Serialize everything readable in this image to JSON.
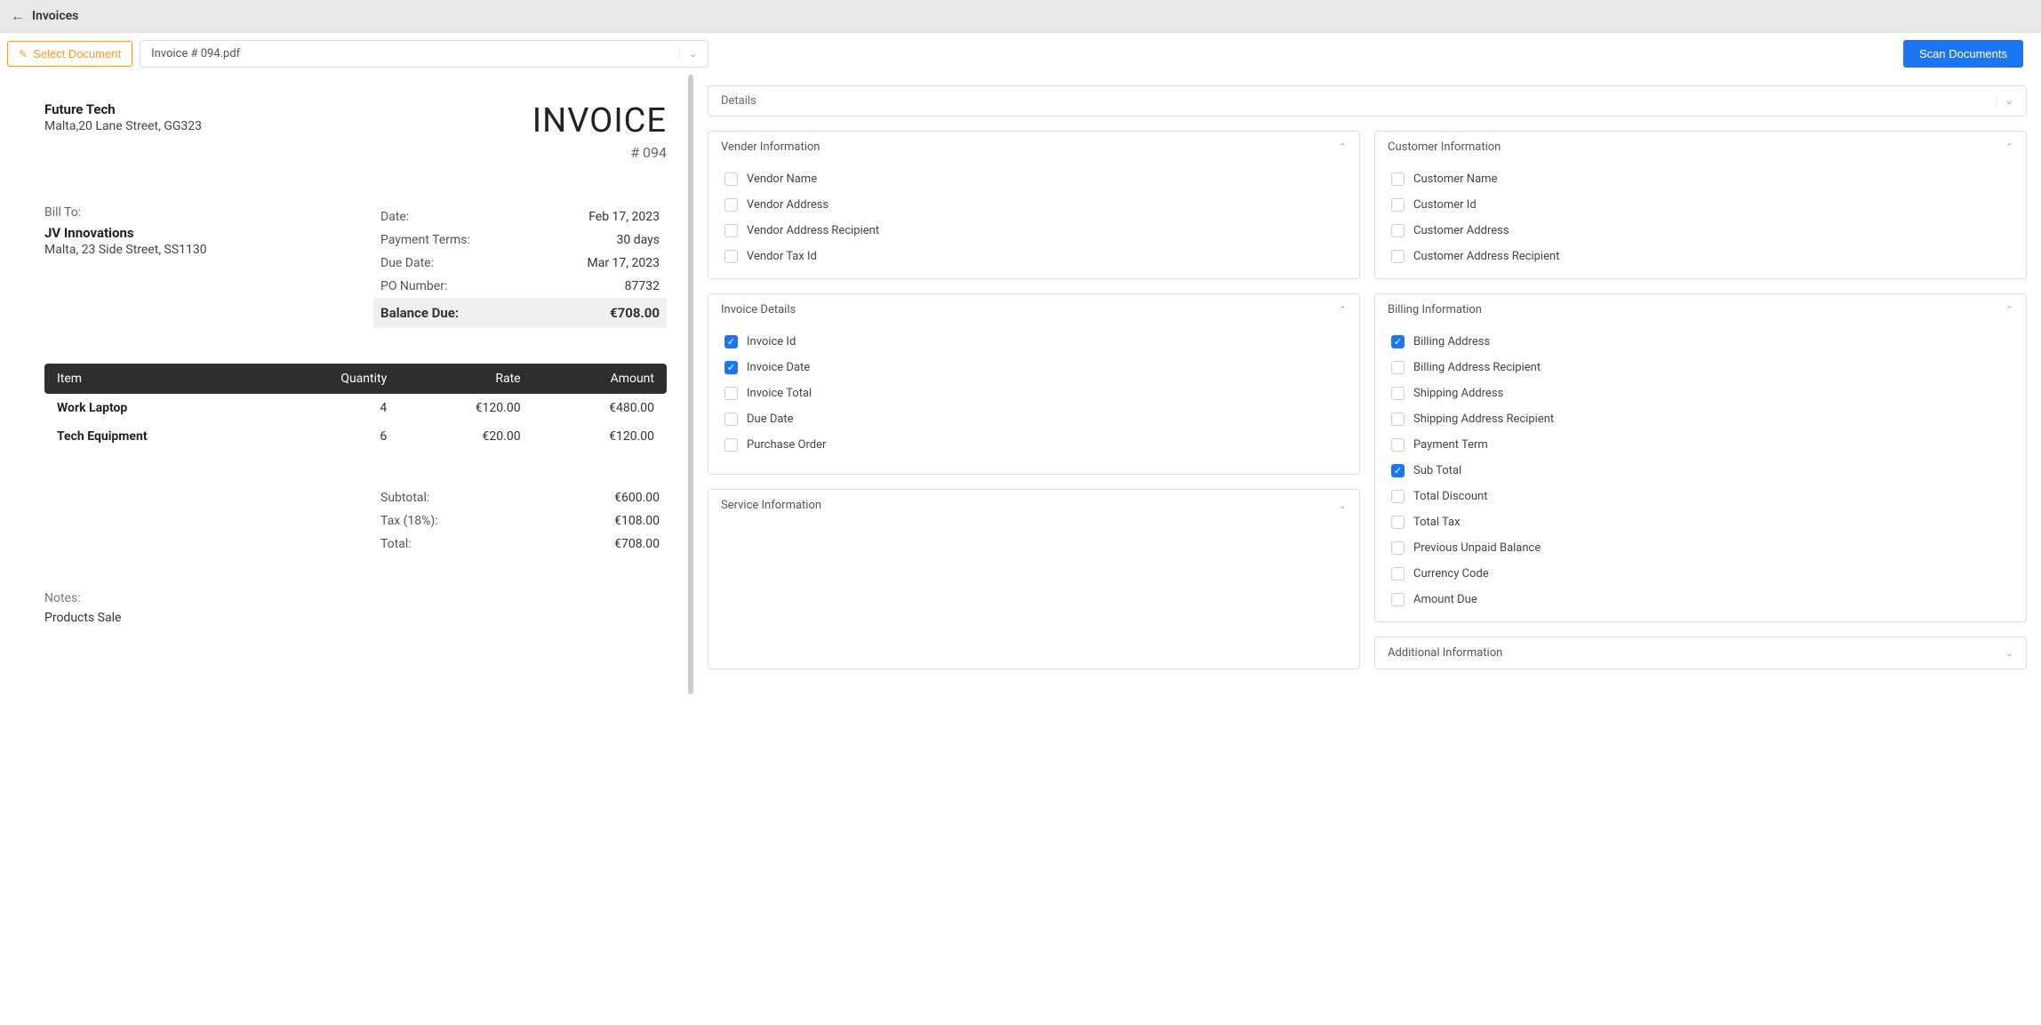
{
  "header": {
    "title": "Invoices"
  },
  "toolbar": {
    "select_doc_label": "Select Document",
    "doc_name": "Invoice # 094.pdf",
    "scan_label": "Scan Documents"
  },
  "invoice": {
    "vendor_name": "Future Tech",
    "vendor_address": "Malta,20 Lane Street, GG323",
    "title": "INVOICE",
    "number": "# 094",
    "bill_to_label": "Bill To:",
    "bill_to_name": "JV Innovations",
    "bill_to_address": "Malta, 23 Side Street, SS1130",
    "meta": {
      "date_label": "Date:",
      "date_value": "Feb 17, 2023",
      "terms_label": "Payment Terms:",
      "terms_value": "30 days",
      "due_label": "Due Date:",
      "due_value": "Mar 17, 2023",
      "po_label": "PO Number:",
      "po_value": "87732",
      "balance_label": "Balance Due:",
      "balance_value": "€708.00"
    },
    "columns": {
      "item": "Item",
      "qty": "Quantity",
      "rate": "Rate",
      "amount": "Amount"
    },
    "items": [
      {
        "name": "Work Laptop",
        "qty": "4",
        "rate": "€120.00",
        "amount": "€480.00"
      },
      {
        "name": "Tech Equipment",
        "qty": "6",
        "rate": "€20.00",
        "amount": "€120.00"
      }
    ],
    "totals": {
      "subtotal_label": "Subtotal:",
      "subtotal_value": "€600.00",
      "tax_label": "Tax (18%):",
      "tax_value": "€108.00",
      "total_label": "Total:",
      "total_value": "€708.00"
    },
    "notes_label": "Notes:",
    "notes_text": "Products Sale"
  },
  "details_dropdown": "Details",
  "panels": {
    "vendor": {
      "title": "Vender Information",
      "fields": [
        {
          "label": "Vendor Name",
          "checked": false
        },
        {
          "label": "Vendor Address",
          "checked": false
        },
        {
          "label": "Vendor Address Recipient",
          "checked": false
        },
        {
          "label": "Vendor Tax Id",
          "checked": false
        }
      ]
    },
    "customer": {
      "title": "Customer Information",
      "fields": [
        {
          "label": "Customer Name",
          "checked": false
        },
        {
          "label": "Customer Id",
          "checked": false
        },
        {
          "label": "Customer Address",
          "checked": false
        },
        {
          "label": "Customer Address Recipient",
          "checked": false
        }
      ]
    },
    "invoice_details": {
      "title": "Invoice Details",
      "fields": [
        {
          "label": "Invoice Id",
          "checked": true
        },
        {
          "label": "Invoice Date",
          "checked": true
        },
        {
          "label": "Invoice Total",
          "checked": false
        },
        {
          "label": "Due Date",
          "checked": false
        },
        {
          "label": "Purchase Order",
          "checked": false
        }
      ]
    },
    "billing": {
      "title": "Billing Information",
      "fields": [
        {
          "label": "Billing Address",
          "checked": true
        },
        {
          "label": "Billing Address Recipient",
          "checked": false
        },
        {
          "label": "Shipping Address",
          "checked": false
        },
        {
          "label": "Shipping Address Recipient",
          "checked": false
        },
        {
          "label": "Payment Term",
          "checked": false
        },
        {
          "label": "Sub Total",
          "checked": true
        },
        {
          "label": "Total Discount",
          "checked": false
        },
        {
          "label": "Total Tax",
          "checked": false
        },
        {
          "label": "Previous Unpaid Balance",
          "checked": false
        },
        {
          "label": "Currency Code",
          "checked": false
        },
        {
          "label": "Amount Due",
          "checked": false
        }
      ]
    },
    "service": {
      "title": "Service Information"
    },
    "additional": {
      "title": "Additional Information"
    }
  }
}
